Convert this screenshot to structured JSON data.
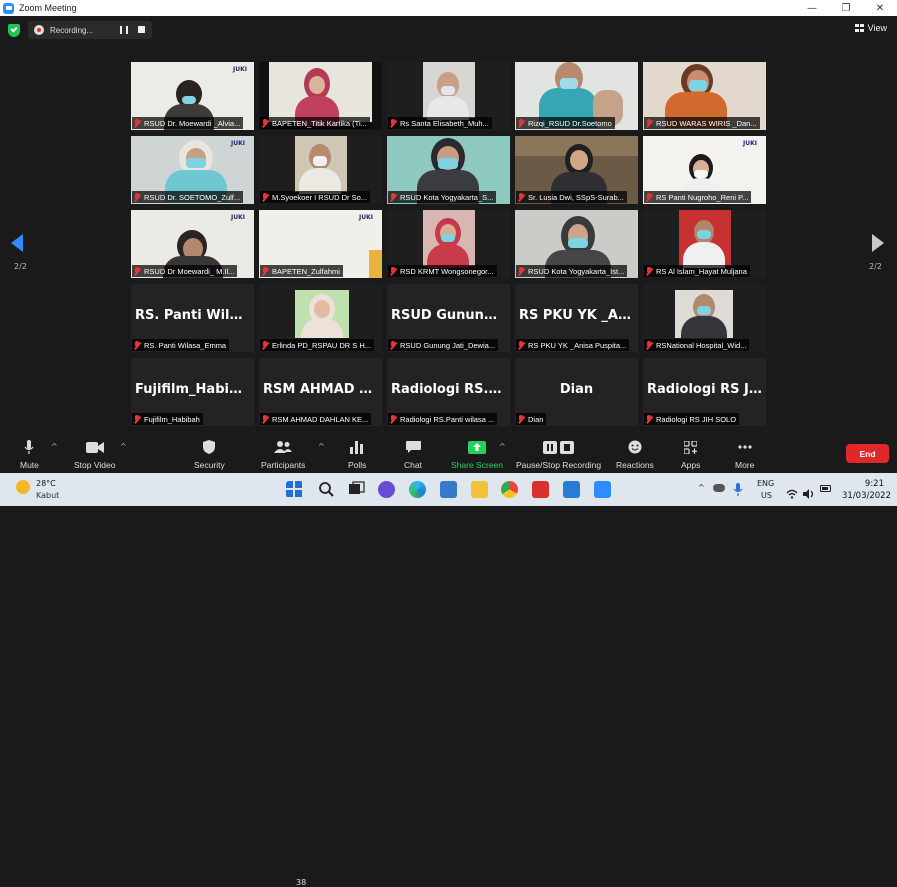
{
  "window": {
    "title": "Zoom Meeting",
    "min": "—",
    "restore": "❐",
    "close": "✕"
  },
  "topbar": {
    "recording": "Recording...",
    "view": "View"
  },
  "pagination": {
    "left": "2/2",
    "right": "2/2"
  },
  "tiles": [
    {
      "name": "RSUD Dr. Moewardi _Alvia...",
      "type": "video"
    },
    {
      "name": "BAPETEN_Titik Kartika (Ti...",
      "type": "video"
    },
    {
      "name": "Rs Santa Elisabeth_Muh...",
      "type": "video"
    },
    {
      "name": "Rizqi_RSUD Dr.Soetomo",
      "type": "video"
    },
    {
      "name": "RSUD WARAS WIRIS _Dan...",
      "type": "video"
    },
    {
      "name": "RSUD Dr. SOETOMO_Zulf...",
      "type": "video"
    },
    {
      "name": "M.Syoekoer I  RSUD Dr So...",
      "type": "video"
    },
    {
      "name": "RSUD Kota Yogyakarta_S...",
      "type": "video"
    },
    {
      "name": "Sr. Lusia Dwi, SSpS-Surab...",
      "type": "video"
    },
    {
      "name": "RS Panti Nugroho_Reni P...",
      "type": "video"
    },
    {
      "name": "RSUD Dr Moewardi_ M.Il...",
      "type": "video"
    },
    {
      "name": "BAPETEN_Zulfahmi",
      "type": "video"
    },
    {
      "name": "RSD KRMT Wongsonegor...",
      "type": "video"
    },
    {
      "name": "RSUD Kota Yogyakarta_Ist...",
      "type": "video"
    },
    {
      "name": "RS Al Islam_Hayat Muljana",
      "type": "video"
    },
    {
      "name": "RS. Panti Wilasa_Emma",
      "type": "text",
      "display": "RS. Panti Wilas..."
    },
    {
      "name": "Erlinda PD_RSPAU DR S H...",
      "type": "video"
    },
    {
      "name": "RSUD Gunung Jati_Dewia...",
      "type": "text",
      "display": "RSUD Gunung J..."
    },
    {
      "name": "RS PKU YK _Anisa Puspita...",
      "type": "text",
      "display": "RS PKU YK _Ani..."
    },
    {
      "name": "RSNational Hospital_Wid...",
      "type": "video"
    },
    {
      "name": "Fujifilm_Habibah",
      "type": "text",
      "display": "Fujifilm_Habibah"
    },
    {
      "name": "RSM AHMAD DAHLAN KE...",
      "type": "text",
      "display": "RSM AHMAD D..."
    },
    {
      "name": "Radiologi RS.Panti wilasa ...",
      "type": "text",
      "display": "Radiologi RS.Pa..."
    },
    {
      "name": "Dian",
      "type": "text",
      "display": "Dian"
    },
    {
      "name": "Radiologi RS JIH SOLO",
      "type": "text",
      "display": "Radiologi RS JI..."
    }
  ],
  "toolbar": {
    "mute": "Mute",
    "stop_video": "Stop Video",
    "security": "Security",
    "participants": "Participants",
    "participants_count": "38",
    "polls": "Polls",
    "chat": "Chat",
    "share_screen": "Share Screen",
    "pause_stop_recording": "Pause/Stop Recording",
    "reactions": "Reactions",
    "apps": "Apps",
    "more": "More",
    "end": "End"
  },
  "taskbar": {
    "temp": "28°C",
    "weather": "Kabut",
    "lang_top": "ENG",
    "lang_bottom": "US",
    "time": "9:21",
    "date": "31/03/2022"
  },
  "colors": {
    "accent": "#2d8cff",
    "end": "#e02828",
    "share": "#23d160"
  }
}
